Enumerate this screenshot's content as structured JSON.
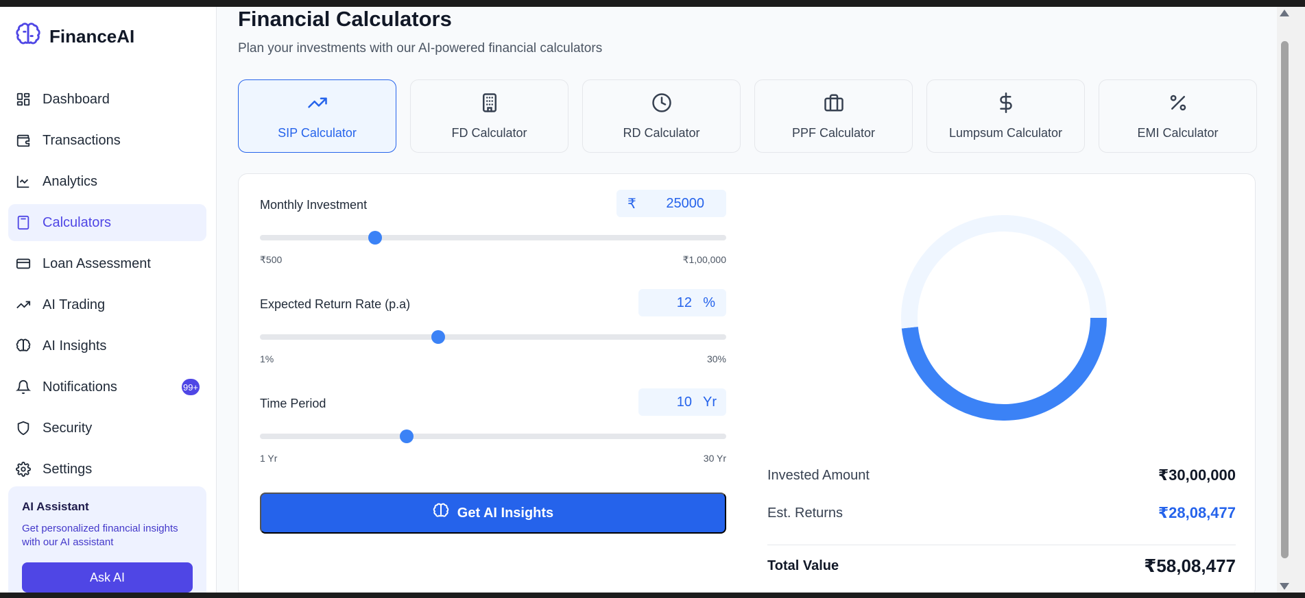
{
  "brand": {
    "name": "FinanceAI",
    "icon": "brain-icon",
    "accent": "#4f46e5"
  },
  "sidebar": {
    "items": [
      {
        "label": "Dashboard",
        "icon": "grid-icon"
      },
      {
        "label": "Transactions",
        "icon": "wallet-icon"
      },
      {
        "label": "Analytics",
        "icon": "line-chart-icon"
      },
      {
        "label": "Calculators",
        "icon": "calculator-icon",
        "active": true
      },
      {
        "label": "Loan Assessment",
        "icon": "credit-card-icon"
      },
      {
        "label": "AI Trading",
        "icon": "trending-up-icon"
      },
      {
        "label": "AI Insights",
        "icon": "brain-icon"
      },
      {
        "label": "Notifications",
        "icon": "bell-icon",
        "badge": "99+"
      },
      {
        "label": "Security",
        "icon": "shield-icon"
      },
      {
        "label": "Settings",
        "icon": "gear-icon"
      }
    ],
    "assistant": {
      "title": "AI Assistant",
      "desc": "Get personalized financial insights with our AI assistant",
      "button": "Ask AI"
    }
  },
  "page": {
    "title": "Financial Calculators",
    "subtitle": "Plan your investments with our AI-powered financial calculators"
  },
  "tabs": [
    {
      "label": "SIP Calculator",
      "icon": "trending-up-icon",
      "active": true
    },
    {
      "label": "FD Calculator",
      "icon": "building-icon"
    },
    {
      "label": "RD Calculator",
      "icon": "clock-icon"
    },
    {
      "label": "PPF Calculator",
      "icon": "briefcase-icon"
    },
    {
      "label": "Lumpsum Calculator",
      "icon": "dollar-icon"
    },
    {
      "label": "EMI Calculator",
      "icon": "percent-icon"
    }
  ],
  "calculator": {
    "investment": {
      "label": "Monthly Investment",
      "prefix": "₹",
      "value": "25000",
      "min": "₹500",
      "max": "₹1,00,000",
      "fraction": 0.247
    },
    "rate": {
      "label": "Expected Return Rate (p.a)",
      "value": "12",
      "suffix": "%",
      "min": "1%",
      "max": "30%",
      "fraction": 0.382
    },
    "period": {
      "label": "Time Period",
      "value": "10",
      "suffix": "Yr",
      "min": "1 Yr",
      "max": "30 Yr",
      "fraction": 0.315
    },
    "cta": "Get AI Insights"
  },
  "results": {
    "invested_label": "Invested Amount",
    "invested_value": "₹30,00,000",
    "returns_label": "Est. Returns",
    "returns_value": "₹28,08,477",
    "total_label": "Total Value",
    "total_value": "₹58,08,477",
    "returns_color": "#2563eb"
  },
  "chart_data": {
    "type": "pie",
    "categories": [
      "Invested Amount",
      "Est. Returns"
    ],
    "values": [
      3000000,
      2808477
    ],
    "colors": [
      "#eff6ff",
      "#3b82f6"
    ],
    "title": ""
  }
}
